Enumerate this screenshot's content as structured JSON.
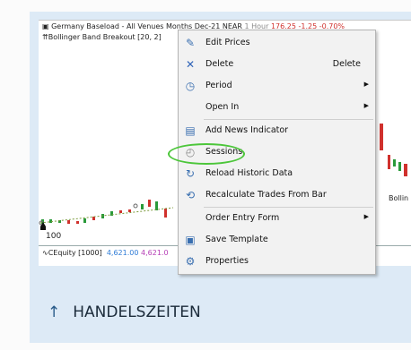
{
  "chart": {
    "title_main": "Germany Baseload - All Venues Months Dec-21 NEAR",
    "title_interval": "1 Hour",
    "title_quote": "176.25 -1.25 -0.70%",
    "indicator": "Bollinger Band Breakout [20, 2]",
    "y_label": "100",
    "indicator_right": "Bollin",
    "equity_label": "CEquity [1000]",
    "equity_v1": "4,621.00",
    "equity_v2": "4,621.0"
  },
  "menu": {
    "items": [
      {
        "label": "Edit Prices",
        "icon": "edit-icon"
      },
      {
        "label": "Delete",
        "shortcut": "Delete",
        "icon": "delete-icon"
      },
      {
        "label": "Period",
        "icon": "clock-icon",
        "submenu": true
      },
      {
        "label": "Open In",
        "submenu": true
      },
      {
        "label": "Add News Indicator",
        "icon": "news-icon"
      },
      {
        "label": "Sessions",
        "icon": "sessions-icon"
      },
      {
        "label": "Reload Historic Data",
        "icon": "reload-icon"
      },
      {
        "label": "Recalculate Trades From Bar",
        "icon": "recalculate-icon"
      },
      {
        "label": "Order Entry Form",
        "submenu": true
      },
      {
        "label": "Save Template",
        "icon": "save-template-icon"
      },
      {
        "label": "Properties",
        "icon": "gear-icon"
      }
    ]
  },
  "footer": {
    "arrow": "↑",
    "label": "HANDELSZEITEN"
  },
  "colors": {
    "highlight": "#4cc63a",
    "panel": "#ddeaf6",
    "price_down": "#d0312d",
    "price_up": "#2a9a3a"
  }
}
